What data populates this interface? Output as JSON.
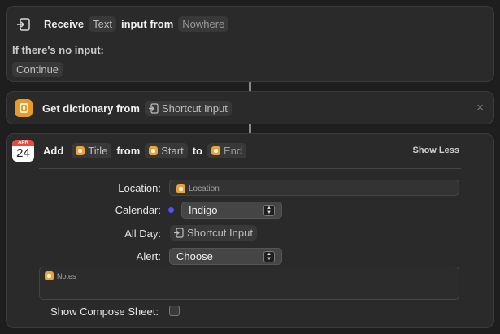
{
  "card1": {
    "receive_label": "Receive",
    "type_token": "Text",
    "input_from_label": "input from",
    "source_token": "Nowhere",
    "no_input_label": "If there's no input:",
    "continue_token": "Continue"
  },
  "card2": {
    "get_dict_label": "Get dictionary from",
    "source_token": "Shortcut Input",
    "close_glyph": "×"
  },
  "card3": {
    "calendar_month": "APR",
    "calendar_day": "24",
    "add_label": "Add",
    "title_token": "Title",
    "from_label": "from",
    "start_token": "Start",
    "to_label": "to",
    "end_token": "End",
    "show_less": "Show Less",
    "location_label": "Location:",
    "location_placeholder": "Location",
    "calendar_label": "Calendar:",
    "calendar_value": "Indigo",
    "calendar_dot_color": "#5a4cff",
    "all_day_label": "All Day:",
    "all_day_token": "Shortcut Input",
    "alert_label": "Alert:",
    "alert_value": "Choose",
    "notes_placeholder": "Notes",
    "compose_label": "Show Compose Sheet:"
  }
}
